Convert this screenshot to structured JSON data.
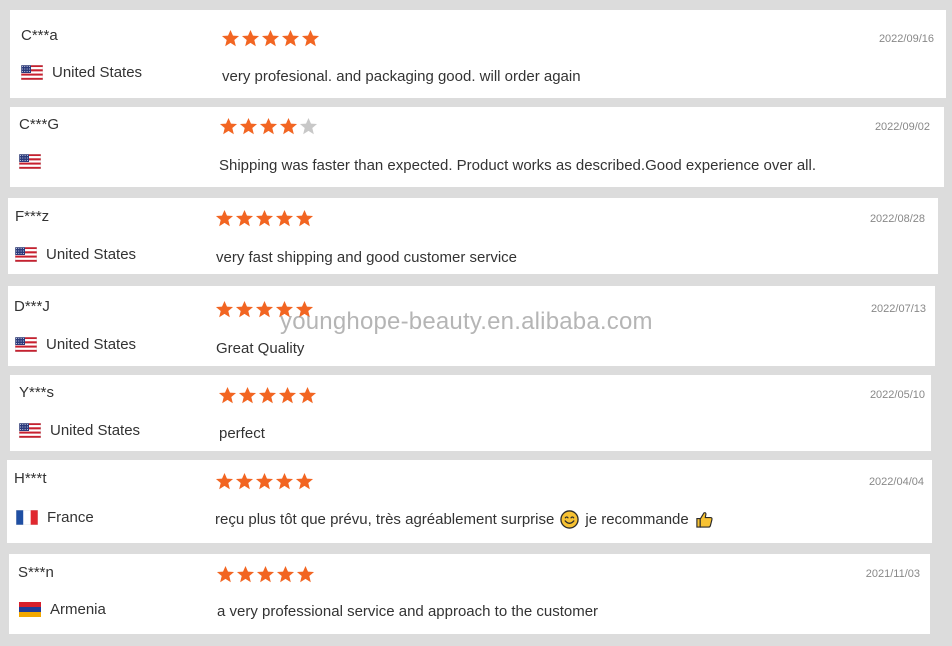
{
  "colors": {
    "star_filled": "#f26522",
    "star_empty": "#c8c8c8"
  },
  "watermark": "younghope-beauty.en.alibaba.com",
  "reviews": [
    {
      "name": "C***a",
      "country": "United States",
      "flag": "us-flag-icon",
      "rating": 5,
      "date": "2022/09/16",
      "comment": "very profesional. and packaging good. will order again"
    },
    {
      "name": "C***G",
      "country": "",
      "flag": "us-flag-icon",
      "rating": 4,
      "date": "2022/09/02",
      "comment": "Shipping was faster than expected. Product works as described.Good experience over all."
    },
    {
      "name": "F***z",
      "country": "United States",
      "flag": "us-flag-icon",
      "rating": 5,
      "date": "2022/08/28",
      "comment": "very fast shipping and good customer service"
    },
    {
      "name": "D***J",
      "country": "United States",
      "flag": "us-flag-icon",
      "rating": 5,
      "date": "2022/07/13",
      "comment": "Great Quality"
    },
    {
      "name": "Y***s",
      "country": "United States",
      "flag": "us-flag-icon",
      "rating": 5,
      "date": "2022/05/10",
      "comment": "perfect"
    },
    {
      "name": "H***t",
      "country": "France",
      "flag": "france-flag-icon",
      "rating": 5,
      "date": "2022/04/04",
      "comment_part1": "reçu plus tôt que prévu, très agréablement surprise",
      "comment_part2": "je recommande",
      "emoji1": "smiling-face-icon",
      "emoji2": "thumbs-up-icon"
    },
    {
      "name": "S***n",
      "country": "Armenia",
      "flag": "armenia-flag-icon",
      "rating": 5,
      "date": "2021/11/03",
      "comment": "a very professional service and approach to the customer"
    }
  ]
}
